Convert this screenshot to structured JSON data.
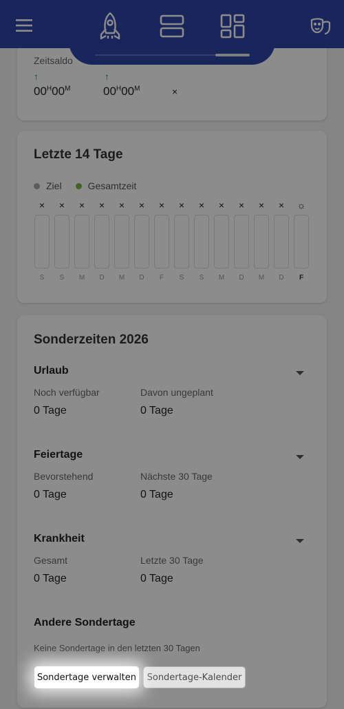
{
  "header": {
    "menu_icon": "hamburger-icon",
    "tabs": [
      {
        "icon": "rocket-icon"
      },
      {
        "icon": "rows-icon"
      },
      {
        "icon": "dashboard-icon"
      }
    ],
    "profile_icon": "theater-masks-icon",
    "colors": {
      "bar": "#2f45a8"
    }
  },
  "zeitsaldo": {
    "label": "Zeitsaldo",
    "time1": {
      "h": "00",
      "hsup": "H",
      "m": "00",
      "msup": "M"
    },
    "time2": {
      "h": "00",
      "hsup": "H",
      "m": "00",
      "msup": "M"
    },
    "close": "×"
  },
  "last14": {
    "title": "Letzte 14 Tage",
    "legend": [
      {
        "label": "Ziel",
        "color": "#a8a8a8"
      },
      {
        "label": "Gesamtzeit",
        "color": "#7cb342"
      }
    ],
    "days": [
      {
        "mark": "×",
        "label": "S"
      },
      {
        "mark": "×",
        "label": "S"
      },
      {
        "mark": "×",
        "label": "M"
      },
      {
        "mark": "×",
        "label": "D"
      },
      {
        "mark": "×",
        "label": "M"
      },
      {
        "mark": "×",
        "label": "D"
      },
      {
        "mark": "×",
        "label": "F"
      },
      {
        "mark": "×",
        "label": "S"
      },
      {
        "mark": "×",
        "label": "S"
      },
      {
        "mark": "×",
        "label": "M"
      },
      {
        "mark": "×",
        "label": "D"
      },
      {
        "mark": "×",
        "label": "M"
      },
      {
        "mark": "×",
        "label": "D"
      },
      {
        "mark": "☼",
        "label": "F"
      }
    ]
  },
  "sonderzeiten": {
    "title": "Sonderzeiten 2026",
    "urlaub": {
      "title": "Urlaub",
      "l1": "Noch verfügbar",
      "v1": "0 Tage",
      "l2": "Davon ungeplant",
      "v2": "0 Tage"
    },
    "feiertage": {
      "title": "Feiertage",
      "l1": "Bevorstehend",
      "v1": "0 Tage",
      "l2": "Nächste 30 Tage",
      "v2": "0 Tage"
    },
    "krankheit": {
      "title": "Krankheit",
      "l1": "Gesamt",
      "v1": "0 Tage",
      "l2": "Letzte 30 Tage",
      "v2": "0 Tage"
    },
    "andere": {
      "title": "Andere Sondertage",
      "note": "Keine Sondertage in den letzten 30 Tagen"
    },
    "btn_manage": "Sondertage verwalten",
    "btn_calendar": "Sondertage-Kalender"
  }
}
